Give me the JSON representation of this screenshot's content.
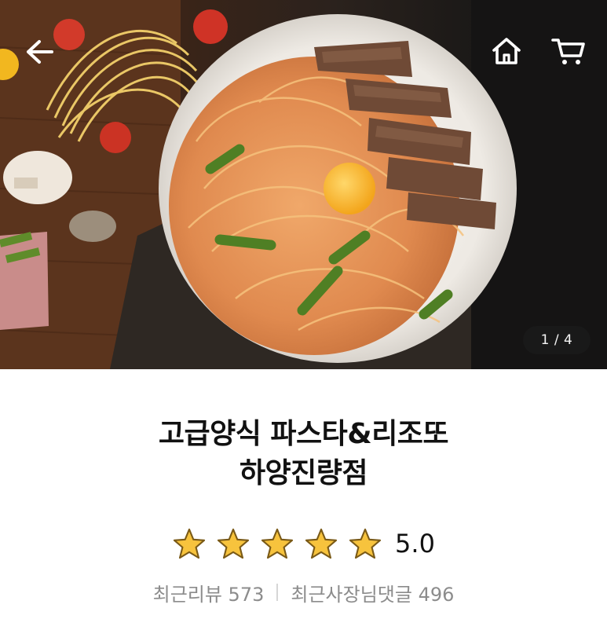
{
  "hero": {
    "image_counter": "1 / 4"
  },
  "header": {
    "back_icon": "arrow-left-icon",
    "home_icon": "home-icon",
    "cart_icon": "cart-icon"
  },
  "store": {
    "name_line1": "고급양식 파스타&리조또",
    "name_line2": "하양진량점",
    "rating_value": 5.0,
    "rating_text": "5.0",
    "stars_filled": 5,
    "stars_total": 5,
    "recent_reviews_text": "최근리뷰 573",
    "recent_owner_replies_text": "최근사장님댓글 496"
  },
  "colors": {
    "star": "#f7c33d",
    "star_outline": "#7a5a17",
    "muted_text": "#8c8c8c"
  }
}
